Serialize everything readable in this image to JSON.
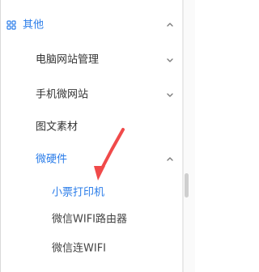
{
  "sidebar": {
    "items": [
      {
        "label": "其他",
        "icon": "grid-icon",
        "chevron": "chevron-up-icon"
      },
      {
        "label": "电脑网站管理",
        "chevron": "chevron-down-icon"
      },
      {
        "label": "手机微网站",
        "chevron": "chevron-down-icon"
      },
      {
        "label": "图文素材"
      },
      {
        "label": "微硬件",
        "chevron": "chevron-up-icon"
      }
    ],
    "submenu": [
      {
        "label": "小票打印机"
      },
      {
        "label": "微信WIFI路由器"
      },
      {
        "label": "微信连WIFI"
      }
    ]
  },
  "colors": {
    "accent": "#2b7de9",
    "text": "#333333",
    "muted": "#7b7b7b",
    "arrow": "#f04a4a"
  }
}
